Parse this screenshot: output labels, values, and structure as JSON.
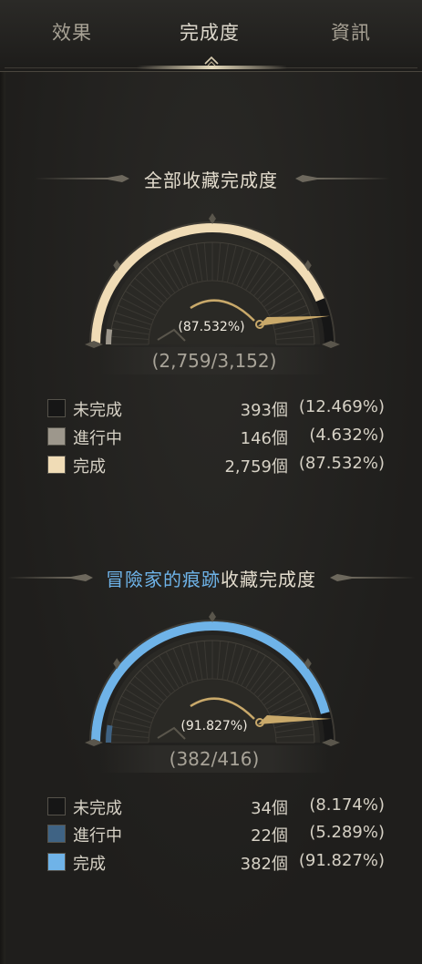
{
  "tabs": [
    {
      "label": "效果",
      "active": false
    },
    {
      "label": "完成度",
      "active": true
    },
    {
      "label": "資訊",
      "active": false
    }
  ],
  "colors": {
    "incomplete": "#161616",
    "overall_in_progress": "#9d978c",
    "overall_complete": "#f0dcb6",
    "adventurer_in_progress": "#3f6384",
    "adventurer_complete": "#6fb3e8",
    "needle": "#c9a96a"
  },
  "overall": {
    "title": "全部收藏完成度",
    "percent_label": "(87.532%)",
    "count_label": "(2,759/3,152)",
    "fractions": {
      "incomplete": 0.12469,
      "in_progress": 0.04632,
      "complete": 0.87532
    },
    "legend": [
      {
        "label": "未完成",
        "count": "393個",
        "pct": "(12.469%)"
      },
      {
        "label": "進行中",
        "count": "146個",
        "pct": "(4.632%)"
      },
      {
        "label": "完成",
        "count": "2,759個",
        "pct": "(87.532%)"
      }
    ]
  },
  "adventurer": {
    "title_highlight": "冒險家的痕跡",
    "title_rest": "收藏完成度",
    "percent_label": "(91.827%)",
    "count_label": "(382/416)",
    "fractions": {
      "incomplete": 0.08174,
      "in_progress": 0.05289,
      "complete": 0.91827
    },
    "legend": [
      {
        "label": "未完成",
        "count": "34個",
        "pct": "(8.174%)"
      },
      {
        "label": "進行中",
        "count": "22個",
        "pct": "(5.289%)"
      },
      {
        "label": "完成",
        "count": "382個",
        "pct": "(91.827%)"
      }
    ]
  }
}
